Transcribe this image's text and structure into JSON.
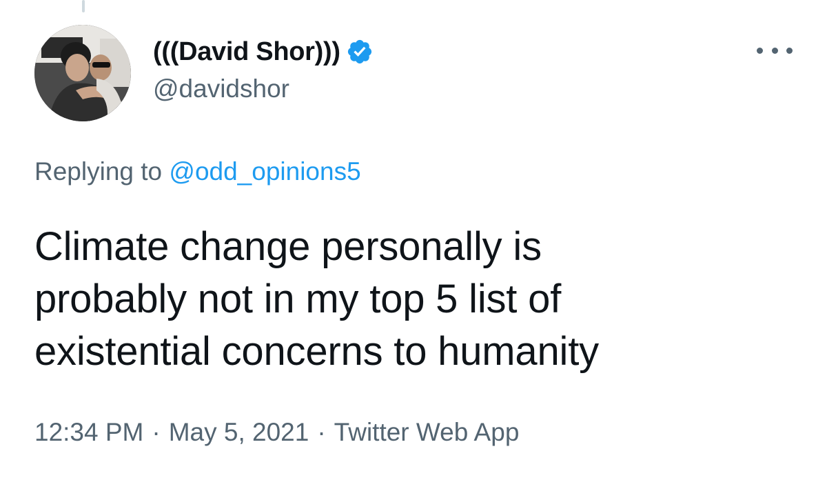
{
  "author": {
    "display_name": "(((David Shor)))",
    "handle": "@davidshor",
    "verified": true,
    "verified_icon": "verified-badge-icon",
    "verified_color": "#1d9bf0"
  },
  "more_menu": {
    "icon": "more-horizontal-icon"
  },
  "reply": {
    "prefix": "Replying to",
    "mention": "@odd_opinions5",
    "link_color": "#1d9bf0"
  },
  "tweet": {
    "lines": [
      "Climate change personally is",
      "probably not in my top 5 list of",
      "existential concerns to humanity"
    ]
  },
  "meta": {
    "time": "12:34 PM",
    "date": "May 5, 2021",
    "source": "Twitter Web App",
    "separator": "·"
  }
}
